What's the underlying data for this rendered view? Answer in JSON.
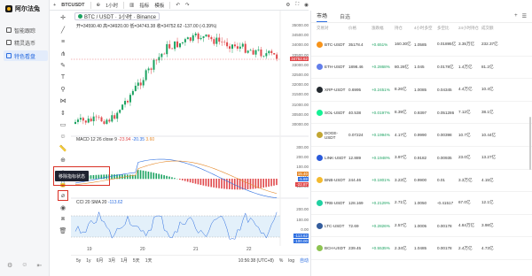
{
  "nav": {
    "logo": "阿尔法兔",
    "items": [
      {
        "label": "智能跟踪",
        "active": false
      },
      {
        "label": "精灵选币",
        "active": false
      },
      {
        "label": "特色看盘",
        "active": true
      }
    ]
  },
  "toolbar": {
    "symbol": "BTCUSDT",
    "interval": "1小时",
    "indicators": "指标",
    "template": "模板"
  },
  "chart": {
    "title": "BTC / USDT · 1小时 · Binance",
    "ohlc": "开=34590.40 高=34920.00 低=34743.38 收=34752.62 -137.00 (-0.39%)",
    "macd_legend": "MACD 12 26 close 9",
    "macd_vals": [
      "-23.94",
      "-20.35",
      "3.60"
    ],
    "cci_legend": "CCI 20 SMA 20",
    "cci_val": "-113.62",
    "price_ticks": [
      "35000.00",
      "34500.00",
      "34000.00",
      "33500.00",
      "33000.00",
      "32500.00",
      "32000.00",
      "31500.00",
      "31000.00",
      "30500.00",
      "30000.00"
    ],
    "last_price": "34752.62",
    "macd_ticks": [
      "300.00",
      "200.00",
      "100.00",
      "0.00",
      "-100.00"
    ],
    "macd_tags": [
      "15.40",
      "-5.88",
      "-22.87"
    ],
    "cci_ticks": [
      "200.00",
      "100.00",
      "0.00",
      "-100.00"
    ],
    "cci_tags": [
      "-113.62",
      "-100.00"
    ],
    "xaxis": [
      "19",
      "20",
      "21",
      "22"
    ],
    "tooltip": "移除指标状态",
    "bottom": {
      "ranges": [
        "5y",
        "1y",
        "6月",
        "3月",
        "1月",
        "5天",
        "1天"
      ],
      "time": "10:56:38 (UTC+8)",
      "pct": "%",
      "log": "log",
      "auto": "自动"
    }
  },
  "market": {
    "tabs": [
      "市场",
      "自选"
    ],
    "columns": [
      "交易对",
      "价格",
      "涨跌幅",
      "持仓",
      "4小时多空",
      "多空比",
      "24小时持仓",
      "成交额"
    ],
    "rows": [
      {
        "pair": "BTC-USDT",
        "price": "35178.4",
        "chg": "+0.651%",
        "oi": "160.30亿",
        "ls4h": "1.0585",
        "ratio": "0.01895亿",
        "oi24": "3.35万亿",
        "vol": "232.37亿",
        "color": "#f7931a"
      },
      {
        "pair": "ETH-USDT",
        "price": "1898.46",
        "chg": "+0.2868%",
        "oi": "80.28亿",
        "ls4h": "1.045",
        "ratio": "0.0178亿",
        "oi24": "1.4万亿",
        "vol": "81.2亿",
        "color": "#627eea"
      },
      {
        "pair": "XRP-USDT",
        "price": "0.6995",
        "chg": "+0.2451%",
        "oi": "8.26亿",
        "ls4h": "1.0085",
        "ratio": "0.04345",
        "oi24": "4.4万亿",
        "vol": "10.4亿",
        "color": "#23292f"
      },
      {
        "pair": "SOL-USDT",
        "price": "40.538",
        "chg": "+0.0197%",
        "oi": "8.39亿",
        "ls4h": "0.9397",
        "ratio": "0.051286",
        "oi24": "7.12亿",
        "vol": "38.1亿",
        "color": "#14f195"
      },
      {
        "pair": "DOGE-USDT",
        "price": "0.07224",
        "chg": "+0.1994%",
        "oi": "4.17亿",
        "ls4h": "0.9990",
        "ratio": "0.00398",
        "oi24": "10.7亿",
        "vol": "10.44亿",
        "color": "#c2a633"
      },
      {
        "pair": "LINK-USDT",
        "price": "12.889",
        "chg": "+0.1948%",
        "oi": "3.97亿",
        "ls4h": "0.9182",
        "ratio": "0.00935",
        "oi24": "23.0亿",
        "vol": "13.27亿",
        "color": "#2a5ada"
      },
      {
        "pair": "BNB-USDT",
        "price": "244.46",
        "chg": "+0.1801%",
        "oi": "3.23亿",
        "ls4h": "0.9900",
        "ratio": "0.01",
        "oi24": "3.3万亿",
        "vol": "4.15亿",
        "color": "#f3ba2f"
      },
      {
        "pair": "TRB-USDT",
        "price": "128.169",
        "chg": "+0.2129%",
        "oi": "2.71亿",
        "ls4h": "1.0050",
        "ratio": "-0.41517",
        "oi24": "67.0亿",
        "vol": "12.1亿",
        "color": "#20d1a2"
      },
      {
        "pair": "LTC-USDT",
        "price": "72.69",
        "chg": "+0.2826%",
        "oi": "2.57亿",
        "ls4h": "1.0005",
        "ratio": "0.00178",
        "oi24": "4.84万亿",
        "vol": "3.98亿",
        "color": "#345d9d"
      },
      {
        "pair": "BCH-USDT",
        "price": "239.45",
        "chg": "+0.5535%",
        "oi": "2.34亿",
        "ls4h": "1.0485",
        "ratio": "0.00178",
        "oi24": "2.4万亿",
        "vol": "4.73亿",
        "color": "#8dc351"
      }
    ]
  }
}
